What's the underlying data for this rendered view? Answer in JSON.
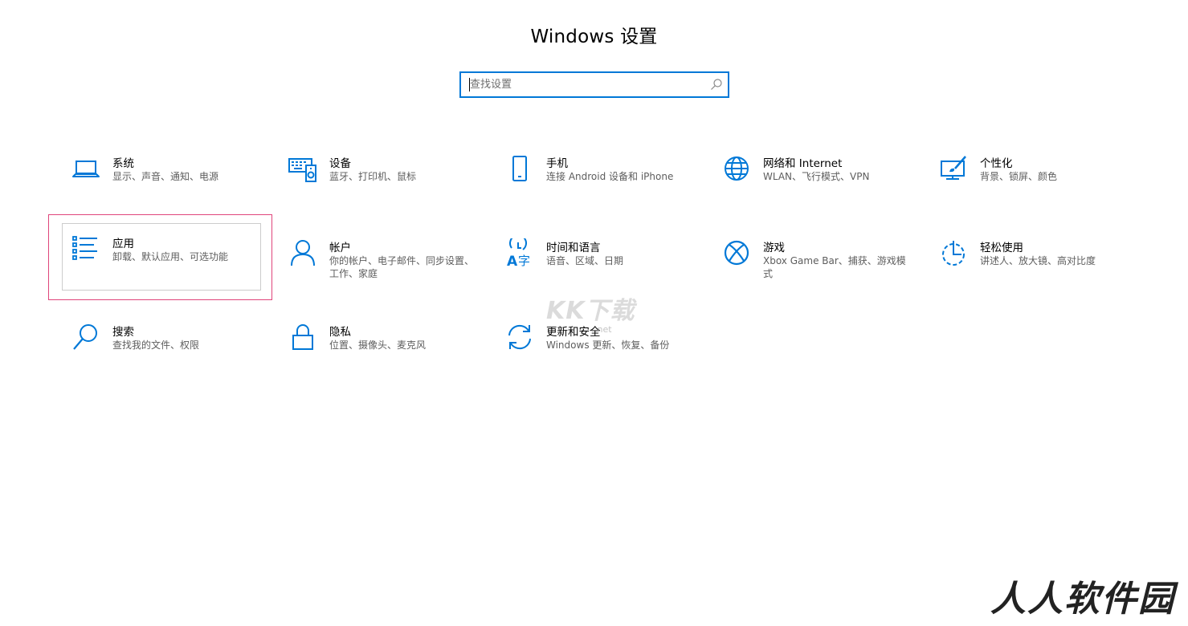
{
  "header": {
    "title": "Windows 设置"
  },
  "search": {
    "placeholder": "查找设置"
  },
  "tiles": [
    {
      "label": "系统",
      "desc": "显示、声音、通知、电源",
      "icon": "laptop-icon"
    },
    {
      "label": "设备",
      "desc": "蓝牙、打印机、鼠标",
      "icon": "devices-icon"
    },
    {
      "label": "手机",
      "desc": "连接 Android 设备和 iPhone",
      "icon": "phone-icon"
    },
    {
      "label": "网络和 Internet",
      "desc": "WLAN、飞行模式、VPN",
      "icon": "globe-icon"
    },
    {
      "label": "个性化",
      "desc": "背景、锁屏、颜色",
      "icon": "personalization-icon"
    },
    {
      "label": "应用",
      "desc": "卸载、默认应用、可选功能",
      "icon": "apps-list-icon"
    },
    {
      "label": "帐户",
      "desc": "你的帐户、电子邮件、同步设置、工作、家庭",
      "icon": "person-icon"
    },
    {
      "label": "时间和语言",
      "desc": "语音、区域、日期",
      "icon": "time-language-icon"
    },
    {
      "label": "游戏",
      "desc": "Xbox Game Bar、捕获、游戏模式",
      "icon": "xbox-icon"
    },
    {
      "label": "轻松使用",
      "desc": "讲述人、放大镜、高对比度",
      "icon": "ease-of-access-icon"
    },
    {
      "label": "搜索",
      "desc": "查找我的文件、权限",
      "icon": "search-icon"
    },
    {
      "label": "隐私",
      "desc": "位置、摄像头、麦克风",
      "icon": "lock-icon"
    },
    {
      "label": "更新和安全",
      "desc": "Windows 更新、恢复、备份",
      "icon": "update-icon"
    }
  ],
  "watermarks": {
    "center": "KK下载",
    "center_sub": ".net",
    "corner": "人人软件园"
  },
  "colors": {
    "accent": "#0078d7",
    "highlight": "#e0457b"
  }
}
